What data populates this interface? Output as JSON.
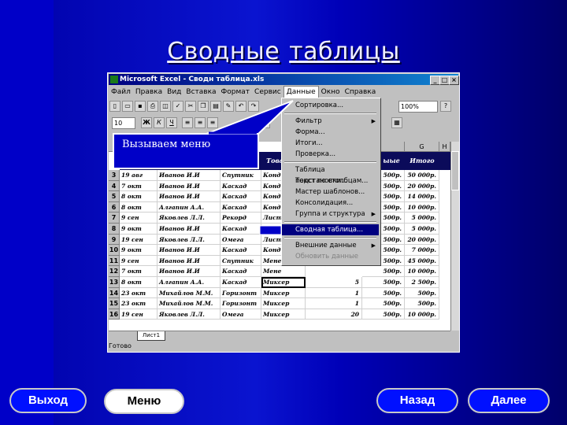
{
  "slide": {
    "title_word1": "Сводные",
    "title_word2": "таблицы"
  },
  "excel": {
    "title": "Microsoft Excel - Сводн таблица.xls",
    "menu": [
      "Файл",
      "Правка",
      "Вид",
      "Вставка",
      "Формат",
      "Сервис",
      "Данные",
      "Окно",
      "Справка"
    ],
    "active_menu_index": 6,
    "font_size": "10",
    "zoom": "100%",
    "columns": [
      "G",
      "H"
    ],
    "header_cells": [
      "Това",
      "ыые",
      "Итого"
    ],
    "rows": [
      {
        "n": "3",
        "date": "19 авг",
        "name": "Иванов И.И",
        "firm": "Спутник",
        "item": "Конд",
        "price": "500р.",
        "total": "50 000р."
      },
      {
        "n": "4",
        "date": "7 окт",
        "name": "Иванов И.И",
        "firm": "Каскад",
        "item": "Конд",
        "price": "500р.",
        "total": "20 000р."
      },
      {
        "n": "5",
        "date": "8 окт",
        "name": "Иванов И.И",
        "firm": "Каскад",
        "item": "Конд",
        "price": "500р.",
        "total": "14 000р."
      },
      {
        "n": "6",
        "date": "8 окт",
        "name": "Алгапин А.А.",
        "firm": "Каскад",
        "item": "Конд",
        "price": "500р.",
        "total": "10 000р."
      },
      {
        "n": "7",
        "date": "9 сен",
        "name": "Яковлев Л.Л.",
        "firm": "Рекорд",
        "item": "Лист",
        "price": "500р.",
        "total": "5 000р."
      },
      {
        "n": "8",
        "date": "9 окт",
        "name": "Иванов И.И",
        "firm": "Каскад",
        "item": "Конд",
        "price": "500р.",
        "total": "5 000р."
      },
      {
        "n": "9",
        "date": "19 сен",
        "name": "Яковлев Л.Л.",
        "firm": "Омега",
        "item": "Лист",
        "price": "500р.",
        "total": "20 000р."
      },
      {
        "n": "10",
        "date": "9 окт",
        "name": "Иванов И.И",
        "firm": "Каскад",
        "item": "Конд",
        "price": "500р.",
        "total": "7 000р."
      },
      {
        "n": "11",
        "date": "9 сен",
        "name": "Иванов И.И",
        "firm": "Спутник",
        "item": "Мене",
        "price": "500р.",
        "total": "45 000р."
      },
      {
        "n": "12",
        "date": "7 окт",
        "name": "Иванов И.И",
        "firm": "Каскад",
        "item": "Мене",
        "price": "500р.",
        "total": "10 000р."
      },
      {
        "n": "13",
        "date": "8 окт",
        "name": "Алгапин А.А.",
        "firm": "Каскад",
        "item": "Миксер",
        "qty": "5",
        "price": "500р.",
        "total": "2 500р."
      },
      {
        "n": "14",
        "date": "23 окт",
        "name": "Михайлов М.М.",
        "firm": "Горизонт",
        "item": "Миксер",
        "qty": "1",
        "price": "500р.",
        "total": "500р."
      },
      {
        "n": "15",
        "date": "23 окт",
        "name": "Михайлов М.М.",
        "firm": "Горизонт",
        "item": "Миксер",
        "qty": "1",
        "price": "500р.",
        "total": "500р."
      },
      {
        "n": "16",
        "date": "19 сен",
        "name": "Яковлев Л.Л.",
        "firm": "Омега",
        "item": "Миксер",
        "qty": "20",
        "price": "500р.",
        "total": "10 000р."
      }
    ],
    "sheet_tab": "Лист1",
    "status": "Готово"
  },
  "dropdown": {
    "items": [
      {
        "label": "Сортировка...",
        "arrow": false
      },
      {
        "label": "Фильтр",
        "arrow": true
      },
      {
        "label": "Форма...",
        "arrow": false
      },
      {
        "label": "Итоги...",
        "arrow": false
      },
      {
        "label": "Проверка...",
        "arrow": false
      },
      {
        "label": "Таблица подстановки...",
        "arrow": false
      },
      {
        "label": "Текст по столбцам...",
        "arrow": false
      },
      {
        "label": "Мастер шаблонов...",
        "arrow": false
      },
      {
        "label": "Консолидация...",
        "arrow": false
      },
      {
        "label": "Группа и структура",
        "arrow": true
      },
      {
        "label": "Сводная таблица...",
        "arrow": false
      },
      {
        "label": "Внешние данные",
        "arrow": true
      },
      {
        "label": "Обновить данные",
        "arrow": false
      }
    ],
    "highlighted_index": 10
  },
  "callout": {
    "text": "Вызываем меню"
  },
  "nav": {
    "exit": "Выход",
    "menu": "Меню",
    "back": "Назад",
    "next": "Далее"
  },
  "colors": {
    "slide_blue": "#0000c8",
    "highlight": "#000080",
    "header_row": "#0b0b5a",
    "nav_button": "#0010ff"
  }
}
